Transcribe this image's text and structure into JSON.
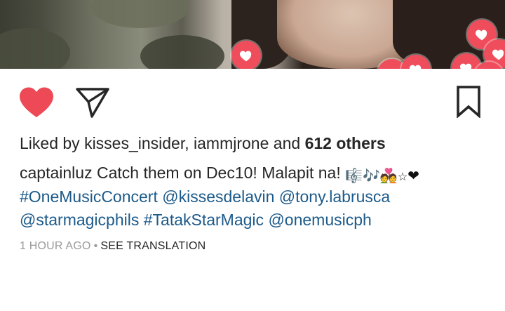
{
  "post": {
    "liked_by_prefix": "Liked by",
    "liked_users": [
      "kisses_insider",
      "iammjrone"
    ],
    "and_label": "and",
    "others_count": "612 others",
    "author": "captainluz",
    "caption_text": "Catch them on Dec10! Malapit na!",
    "caption_emojis": [
      "🎼",
      "🎶",
      "💑",
      "☆",
      "❤"
    ],
    "mentions_line2": [
      "#OneMusicConcert",
      "@kissesdelavin",
      "@tony.labrusca"
    ],
    "mentions_line3": [
      "@starmagicphils",
      "#TatakStarMagic",
      "@onemusicph"
    ],
    "time_ago": "1 HOUR AGO",
    "see_translation": "SEE TRANSLATION"
  },
  "colors": {
    "like_red": "#ed4956",
    "link_blue": "#1c5a8a",
    "meta_gray": "#9a9a9a",
    "icon_dark": "#262626"
  },
  "icons": {
    "like": "heart-icon",
    "share": "paper-plane-icon",
    "save": "bookmark-icon"
  }
}
